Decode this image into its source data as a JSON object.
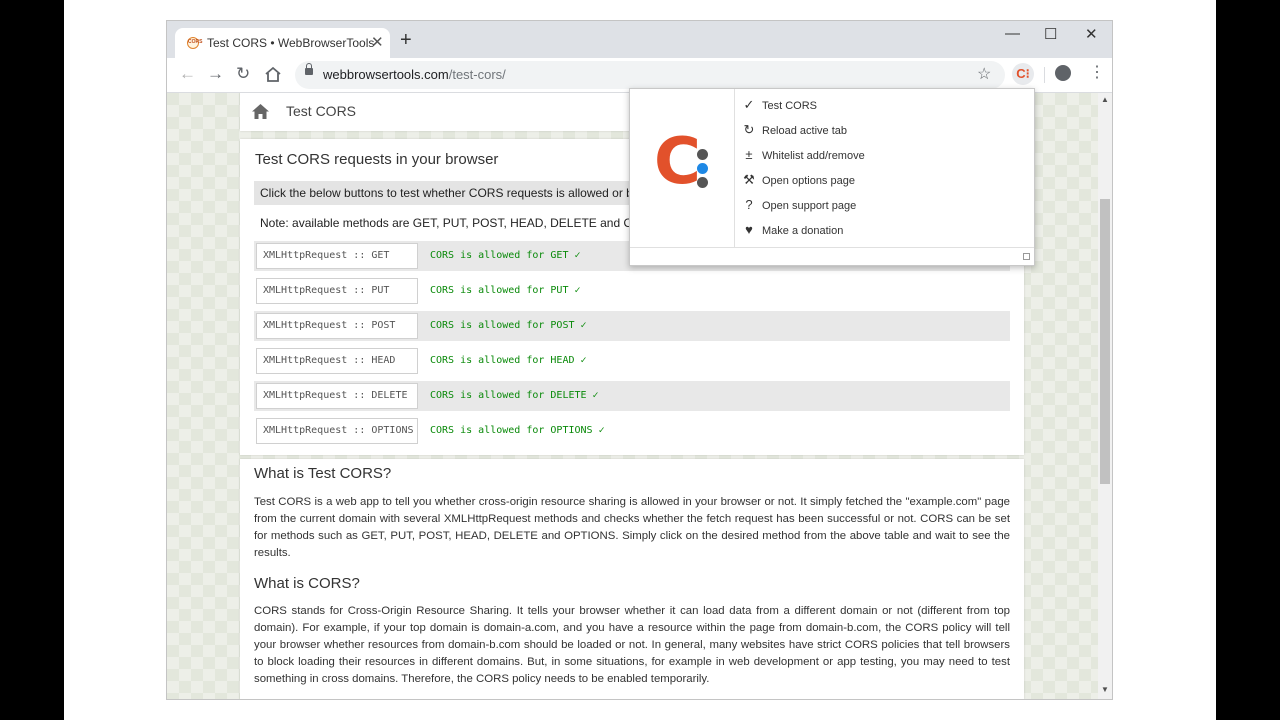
{
  "browser": {
    "tab_title": "Test CORS • WebBrowserTools",
    "tab_close": "✕",
    "new_tab": "+",
    "window_controls": {
      "minimize": "—",
      "maximize": "☐",
      "close": "✕"
    },
    "url_host": "webbrowsertools.com",
    "url_path": "/test-cors/",
    "extension_icon_text": "C⁝",
    "icons": [
      "back-icon",
      "forward-icon",
      "reload-icon",
      "home-icon",
      "lock-icon",
      "star-icon",
      "profile-icon",
      "menu-icon"
    ]
  },
  "page": {
    "breadcrumb": "Test CORS",
    "heading": "Test CORS requests in your browser",
    "infobar": "Click the below buttons to test whether CORS requests is allowed or blo",
    "note": "Note: available methods are GET, PUT, POST, HEAD, DELETE and OP",
    "rows": [
      {
        "method": "XMLHttpRequest :: GET",
        "result": "CORS is allowed for GET ✓"
      },
      {
        "method": "XMLHttpRequest :: PUT",
        "result": "CORS is allowed for PUT ✓"
      },
      {
        "method": "XMLHttpRequest :: POST",
        "result": "CORS is allowed for POST ✓"
      },
      {
        "method": "XMLHttpRequest :: HEAD",
        "result": "CORS is allowed for HEAD ✓"
      },
      {
        "method": "XMLHttpRequest :: DELETE",
        "result": "CORS is allowed for DELETE ✓"
      },
      {
        "method": "XMLHttpRequest :: OPTIONS",
        "result": "CORS is allowed for OPTIONS ✓"
      }
    ],
    "what_test_heading": "What is Test CORS?",
    "what_test_text": "Test CORS is a web app to tell you whether cross-origin resource sharing is allowed in your browser or not. It simply fetched the \"example.com\" page from the current domain with several XMLHttpRequest methods and checks whether the fetch request has been successful or not. CORS can be set for methods such as GET, PUT, POST, HEAD, DELETE and OPTIONS. Simply click on the desired method from the above table and wait to see the results.",
    "what_cors_heading": "What is CORS?",
    "what_cors_text": "CORS stands for Cross-Origin Resource Sharing. It tells your browser whether it can load data from a different domain or not (different from top domain). For example, if your top domain is domain-a.com, and you have a resource within the page from domain-b.com, the CORS policy will tell your browser whether resources from domain-b.com should be loaded or not. In general, many websites have strict CORS policies that tell browsers to block loading their resources in different domains. But, in some situations, for example in web development or app testing, you may need to test something in cross domains. Therefore, the CORS policy needs to be enabled temporarily."
  },
  "popup": {
    "logo_letter": "C",
    "dot_colors": [
      "#555555",
      "#1e88e5",
      "#555555"
    ],
    "items": [
      {
        "icon": "✓",
        "label": "Test CORS"
      },
      {
        "icon": "↻",
        "label": "Reload active tab"
      },
      {
        "icon": "±",
        "label": "Whitelist add/remove"
      },
      {
        "icon": "⚒",
        "label": "Open options page"
      },
      {
        "icon": "?",
        "label": "Open support page"
      },
      {
        "icon": "♥",
        "label": "Make a donation"
      }
    ]
  },
  "colors": {
    "brand_orange": "#e2512b",
    "result_green": "#0a8a0a"
  }
}
